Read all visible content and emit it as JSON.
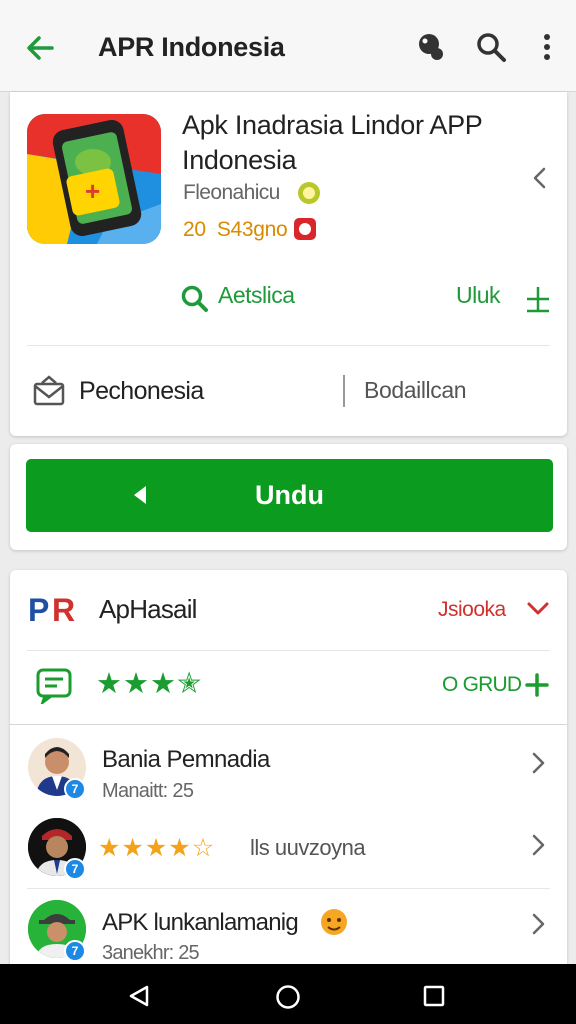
{
  "topbar": {
    "title": "APR Indonesia",
    "back_icon": "arrow-left-icon",
    "icons": [
      "pin-icon",
      "search-icon",
      "more-vert-icon"
    ]
  },
  "app": {
    "title": "Apk Inadrasia Lindor APP Indonesia",
    "developer": "Fleonahicu",
    "size": "20  S43gno",
    "action_left": "Aetslica",
    "action_right": "Uluk",
    "category": "Pechonesia",
    "category_right": "Bodaillcan"
  },
  "install": {
    "label": "Undu"
  },
  "ratings": {
    "brand_label": "ApHasail",
    "sort_label": "Jsiooka",
    "add_label": "O GRUD",
    "stars": 4
  },
  "reviews": [
    {
      "name": "Bania Pemnadia",
      "meta": "Manaitt: 25",
      "badge": "7"
    },
    {
      "name": "",
      "meta": "lls uuvzoyna",
      "badge": "7",
      "stars": 4
    },
    {
      "name": "APK lunkanlamanig",
      "meta": "3anekhr: 25",
      "badge": "7"
    }
  ],
  "colors": {
    "accent_green": "#0a9b1f",
    "link_green": "#1f9a3a",
    "size_orange": "#d88a00",
    "sort_red": "#d0312d",
    "star_green": "#1a9c2e",
    "star_orange": "#f3a21a"
  }
}
